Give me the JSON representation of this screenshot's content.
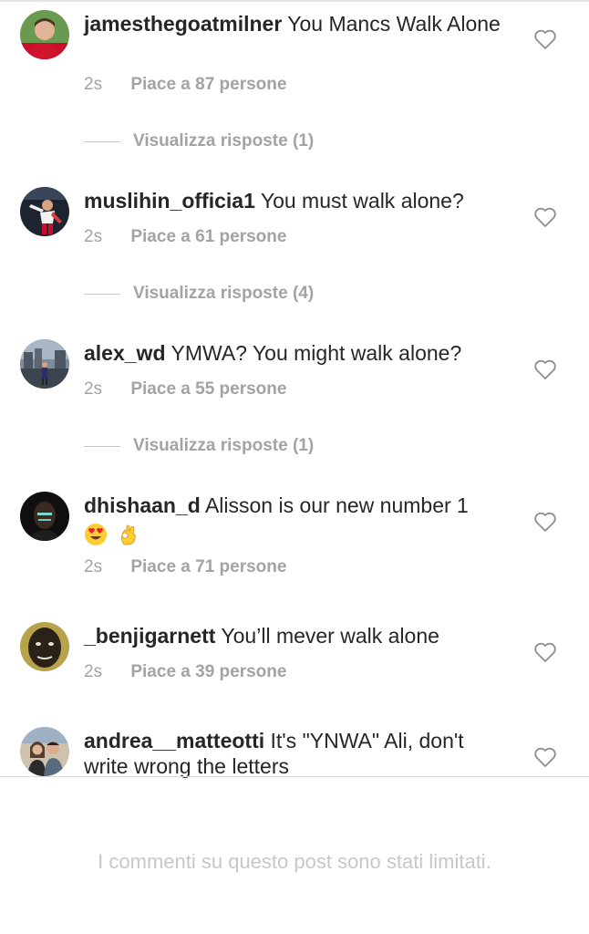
{
  "comments": [
    {
      "username": "jamesthegoatmilner",
      "text": "You Mancs Walk Alone",
      "time": "2s",
      "likes": "Piace a 87 persone",
      "replies_label": "Visualizza risposte (1)",
      "avatar_icon": "liverpool-player-avatar"
    },
    {
      "username": "muslihin_officia1",
      "text": "You must walk alone?",
      "time": "2s",
      "likes": "Piace a 61 persone",
      "replies_label": "Visualizza risposte (4)",
      "avatar_icon": "player-celebrating-avatar"
    },
    {
      "username": "alex_wd",
      "text": "YMWA? You might walk alone?",
      "time": "2s",
      "likes": "Piace a 55 persone",
      "replies_label": "Visualizza risposte (1)",
      "avatar_icon": "city-scene-avatar"
    },
    {
      "username": "dhishaan_d",
      "text": "Alisson is our new number 1",
      "emojis": [
        "heart-eyes-emoji",
        "ok-hand-emoji"
      ],
      "time": "2s",
      "likes": "Piace a 71 persone",
      "avatar_icon": "portrait-avatar"
    },
    {
      "username": "_benjigarnett",
      "text": "You’ll mever walk alone",
      "time": "2s",
      "likes": "Piace a 39 persone",
      "avatar_icon": "face-avatar"
    },
    {
      "username": "andrea__matteotti",
      "text": "It's \"YNWA\" Ali, don't write wrong the letters",
      "avatar_icon": "couple-avatar"
    }
  ],
  "footer": {
    "limited_text": "I commenti su questo post sono stati limitati."
  },
  "colors": {
    "text": "#262626",
    "meta": "#a3a3a3",
    "footer_text": "#c7c7c7"
  }
}
